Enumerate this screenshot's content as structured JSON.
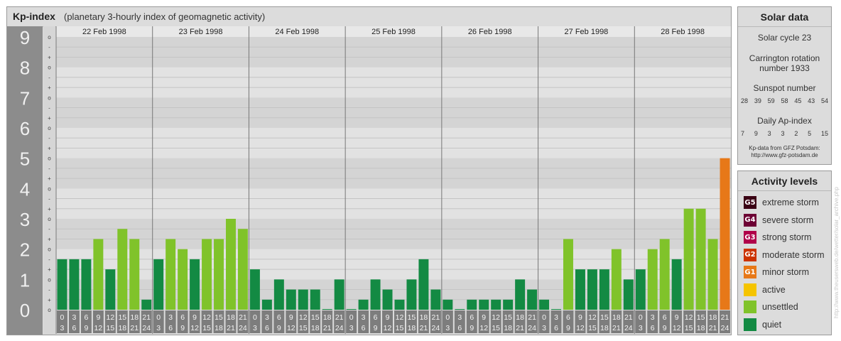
{
  "chart_title": "Kp-index",
  "chart_subtitle": "(planetary 3-hourly index of geomagnetic activity)",
  "chart_data": {
    "type": "bar",
    "title": "Kp-index",
    "subtitle": "(planetary 3-hourly index of geomagnetic activity)",
    "ylim": [
      0,
      9
    ],
    "y_tick_labels": [
      "0",
      "1",
      "2",
      "3",
      "4",
      "5",
      "6",
      "7",
      "8",
      "9"
    ],
    "y_minor_labels": [
      "o",
      "+",
      "-",
      "o"
    ],
    "days": [
      "22 Feb 1998",
      "23 Feb 1998",
      "24 Feb 1998",
      "25 Feb 1998",
      "26 Feb 1998",
      "27 Feb 1998",
      "28 Feb 1998"
    ],
    "interval_start_labels": [
      "0",
      "3",
      "6",
      "9",
      "12",
      "15",
      "18",
      "21"
    ],
    "interval_end_labels": [
      "3",
      "6",
      "9",
      "12",
      "15",
      "18",
      "21",
      "24"
    ],
    "values": [
      1.667,
      1.667,
      1.667,
      2.333,
      1.333,
      2.667,
      2.333,
      0.333,
      1.667,
      2.333,
      2.0,
      1.667,
      2.333,
      2.333,
      3.0,
      2.667,
      1.333,
      0.333,
      1.0,
      0.667,
      0.667,
      0.667,
      0.0,
      1.0,
      0.0,
      0.333,
      1.0,
      0.667,
      0.333,
      1.0,
      1.667,
      0.667,
      0.333,
      0.0,
      0.333,
      0.333,
      0.333,
      0.333,
      1.0,
      0.667,
      0.333,
      0.0,
      2.333,
      1.333,
      1.333,
      1.333,
      2.0,
      1.0,
      1.333,
      2.0,
      2.333,
      1.667,
      3.333,
      3.333,
      2.333,
      5.0
    ],
    "colors": {
      "quiet": "#138a43",
      "unsettled": "#80c32a",
      "active": "#f5c400",
      "minor_storm": "#e77818",
      "moderate_storm": "#cc3300",
      "strong_storm": "#b0004a",
      "severe_storm": "#6d0034",
      "extreme_storm": "#3a0014"
    },
    "grid": true
  },
  "solar": {
    "title": "Solar data",
    "solar_cycle": "Solar cycle 23",
    "carrington_line1": "Carrington rotation",
    "carrington_line2": "number 1933",
    "sunspot_title": "Sunspot number",
    "sunspot_values": [
      "28",
      "39",
      "59",
      "58",
      "45",
      "43",
      "54"
    ],
    "ap_title": "Daily Ap-index",
    "ap_values": [
      "7",
      "9",
      "3",
      "3",
      "2",
      "5",
      "15"
    ],
    "source_line1": "Kp-data from GFZ Potsdam:",
    "source_line2": "http://www.gfz-potsdam.de"
  },
  "activity": {
    "title": "Activity levels",
    "items": [
      {
        "badge": "G5",
        "label": "extreme storm",
        "color": "#3a0014"
      },
      {
        "badge": "G4",
        "label": "severe storm",
        "color": "#6d0034"
      },
      {
        "badge": "G3",
        "label": "strong storm",
        "color": "#b0004a"
      },
      {
        "badge": "G2",
        "label": "moderate storm",
        "color": "#cc3300"
      },
      {
        "badge": "G1",
        "label": "minor storm",
        "color": "#e77818"
      },
      {
        "badge": "",
        "label": "active",
        "color": "#f5c400"
      },
      {
        "badge": "",
        "label": "unsettled",
        "color": "#80c32a"
      },
      {
        "badge": "",
        "label": "quiet",
        "color": "#138a43"
      }
    ]
  },
  "watermark": "http://www.theusersweb.de/wetter/solar_archive.php"
}
